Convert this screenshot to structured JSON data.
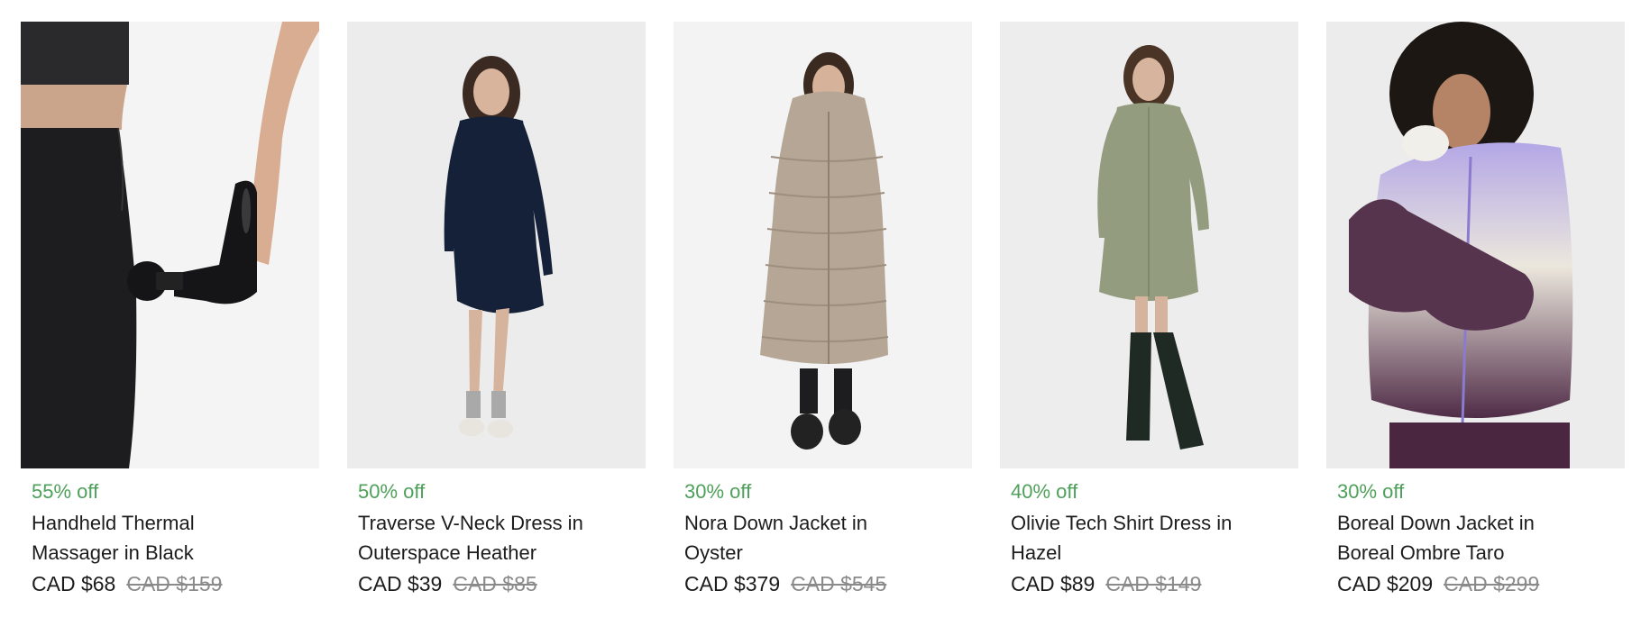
{
  "products": [
    {
      "discount": "55% off",
      "name": "Handheld Thermal Massager in Black",
      "price": "CAD $68",
      "original_price": "CAD $159",
      "image_icon": "massager-product-photo"
    },
    {
      "discount": "50% off",
      "name": "Traverse V-Neck Dress in Outerspace Heather",
      "price": "CAD $39",
      "original_price": "CAD $85",
      "image_icon": "navy-dress-product-photo"
    },
    {
      "discount": "30% off",
      "name": "Nora Down Jacket in Oyster",
      "price": "CAD $379",
      "original_price": "CAD $545",
      "image_icon": "long-puffer-jacket-product-photo"
    },
    {
      "discount": "40% off",
      "name": "Olivie Tech Shirt Dress in Hazel",
      "price": "CAD $89",
      "original_price": "CAD $149",
      "image_icon": "shirt-dress-product-photo"
    },
    {
      "discount": "30% off",
      "name": "Boreal Down Jacket in Boreal Ombre Taro",
      "price": "CAD $209",
      "original_price": "CAD $299",
      "image_icon": "ombre-puffer-jacket-product-photo"
    }
  ],
  "colors": {
    "discount": "#4ea05a",
    "text": "#1c1c1c",
    "strikethrough": "#8a8a8a"
  }
}
